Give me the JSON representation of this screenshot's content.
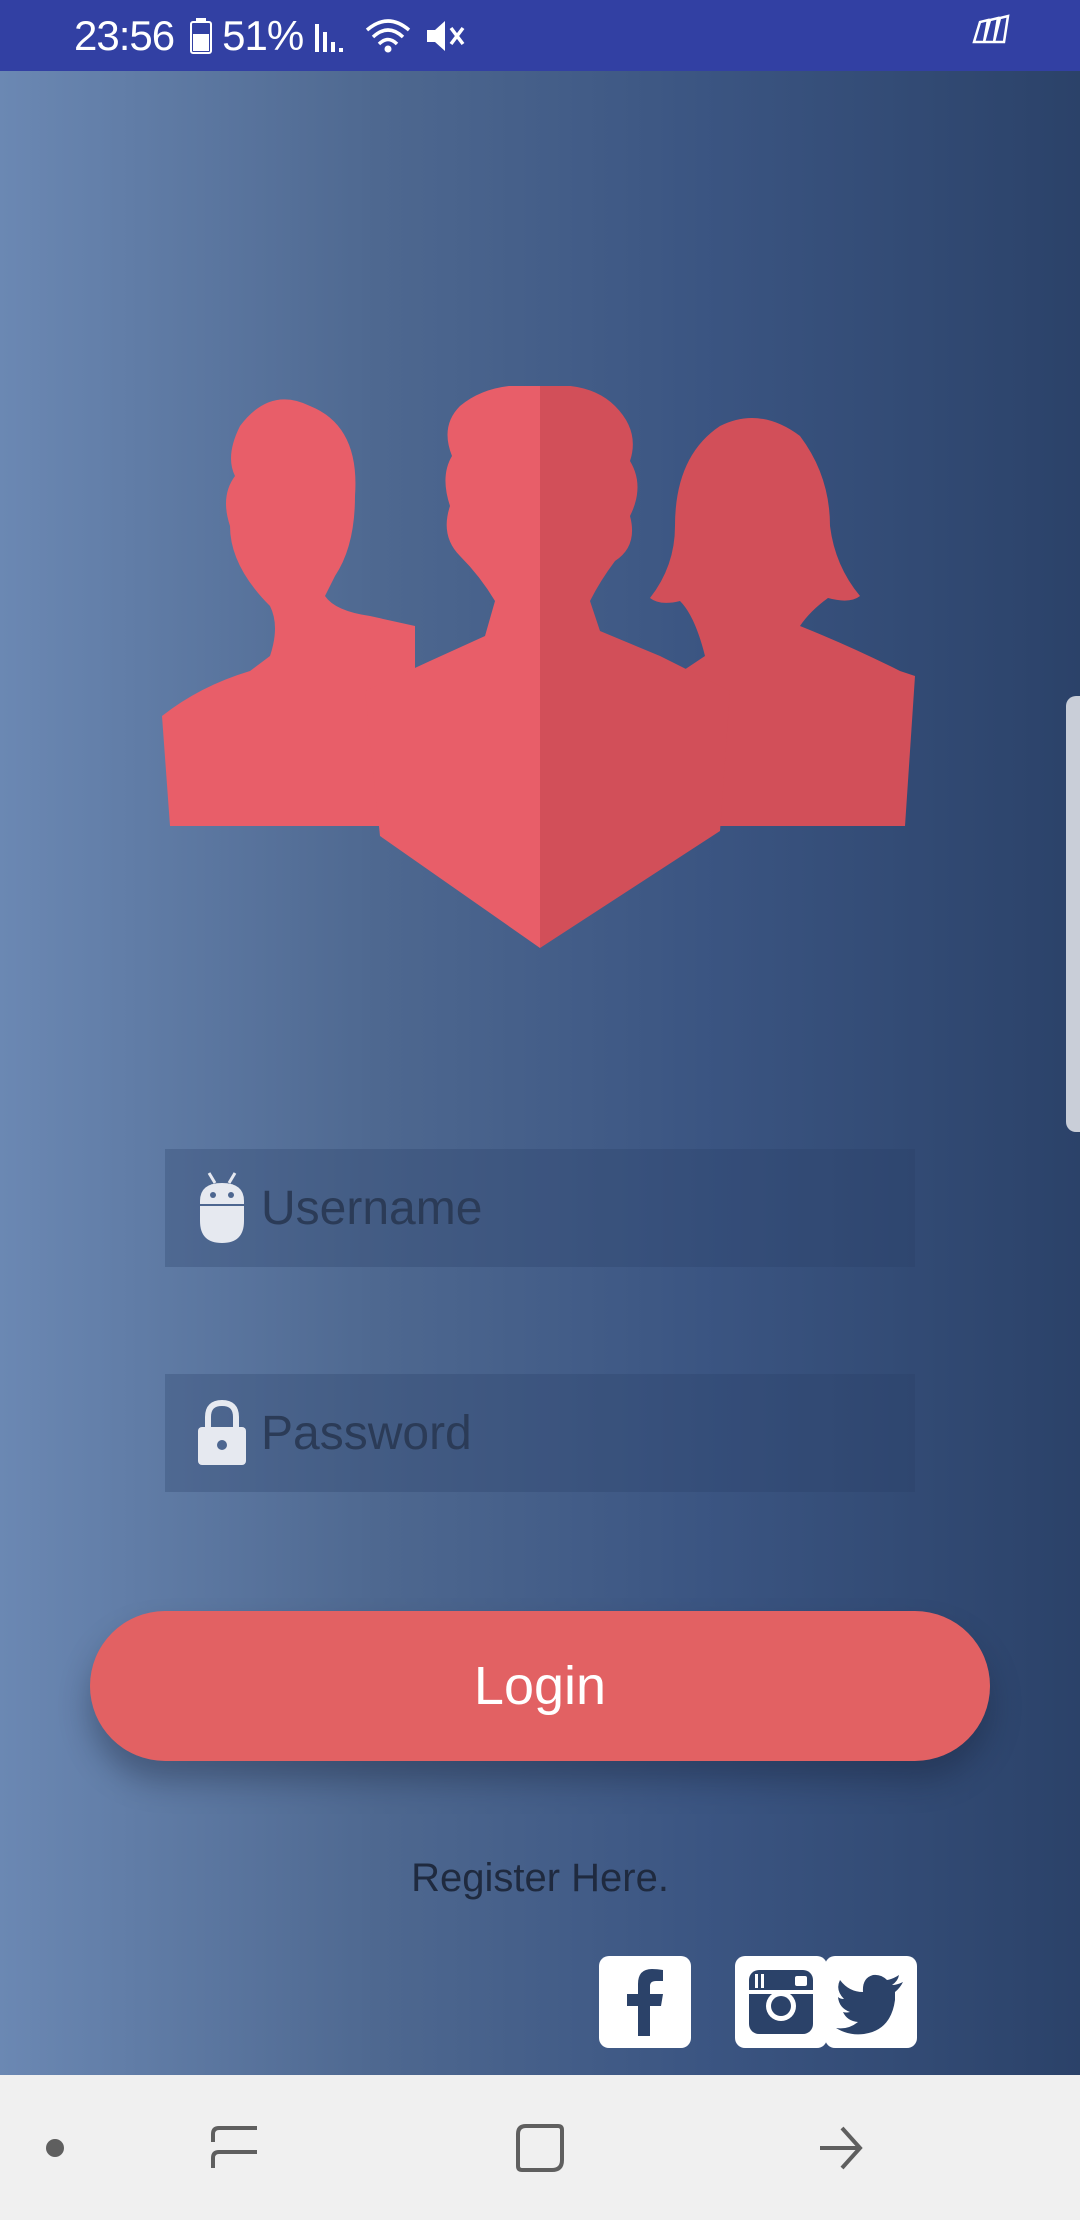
{
  "status_bar": {
    "time": "23:56",
    "battery": "51%",
    "icons": [
      "battery-icon",
      "signal-icon",
      "wifi-icon",
      "mute-icon",
      "app-notification-icon"
    ]
  },
  "login": {
    "username_placeholder": "Username",
    "password_placeholder": "Password",
    "login_label": "Login",
    "register_label": "Register Here."
  },
  "social": [
    "facebook-icon",
    "instagram-icon",
    "twitter-icon"
  ],
  "colors": {
    "status_bar": "#3240a3",
    "accent": "#e26163",
    "logo_light": "#e85e69",
    "logo_dark": "#d24f59"
  }
}
